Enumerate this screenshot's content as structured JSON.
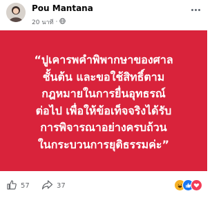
{
  "post": {
    "author": "Pou Mantana",
    "timestamp": "20 นาที",
    "separator": "·",
    "audience_icon": "globe-icon",
    "text_lines": [
      "“ปูเคารพคำพิพากษาของศาล",
      "ชั้นต้น และขอใช้สิทธิ์ตาม",
      "กฎหมายในการยื่นอุทธรณ์",
      "ต่อไป เพื่อให้ข้อเท็จจริงได้รับ",
      "การพิจารณาอย่างครบถ้วน",
      "ในกระบวนการยุติธรรมค่ะ”"
    ],
    "background_color": "#d9233b"
  },
  "stats": {
    "likes": "57",
    "shares": "37",
    "like_icon": "thumbs-up-icon",
    "share_icon": "share-arrow-icon"
  },
  "reactions": [
    "haha-reaction-icon",
    "like-reaction-icon",
    "love-reaction-icon"
  ]
}
